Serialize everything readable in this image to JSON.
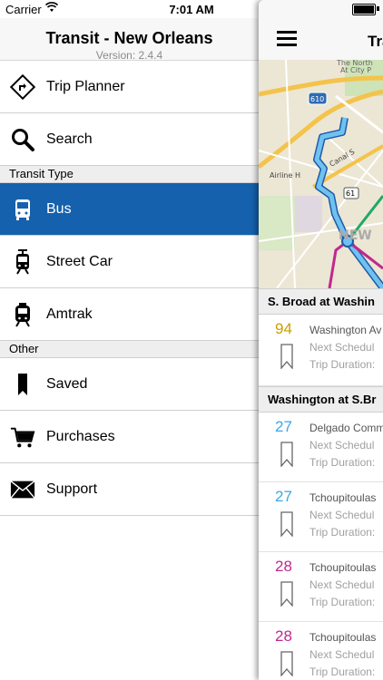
{
  "status": {
    "carrier": "Carrier",
    "time": "7:01 AM"
  },
  "menu": {
    "title": "Transit - New Orleans",
    "version": "Version: 2.4.4",
    "items_top": [
      {
        "label": "Trip Planner",
        "icon": "directions-sign-icon"
      },
      {
        "label": "Search",
        "icon": "search-icon"
      }
    ],
    "section_transit": "Transit Type",
    "items_transit": [
      {
        "label": "Bus",
        "icon": "bus-icon"
      },
      {
        "label": "Street Car",
        "icon": "streetcar-icon"
      },
      {
        "label": "Amtrak",
        "icon": "train-icon"
      }
    ],
    "section_other": "Other",
    "items_other": [
      {
        "label": "Saved",
        "icon": "bookmark-icon"
      },
      {
        "label": "Purchases",
        "icon": "cart-icon"
      },
      {
        "label": "Support",
        "icon": "envelope-icon"
      }
    ],
    "selected_color": "#1561ad"
  },
  "panel": {
    "nav_title": "Transi",
    "map": {
      "labels": [
        "The North",
        "At City P",
        "610",
        "Canal S",
        "Airline H",
        "61",
        "NEW"
      ]
    },
    "stop1": {
      "name": "S. Broad at Washin",
      "arrivals": [
        {
          "route": "94",
          "color": "#c9a000",
          "dest": "Washington Av",
          "next": "Next Schedul",
          "duration": "Trip Duration:"
        }
      ]
    },
    "stop2": {
      "name": "Washington at S.Br",
      "arrivals": [
        {
          "route": "27",
          "color": "#3da6e6",
          "dest": "Delgado Comm",
          "next": "Next Schedul",
          "duration": "Trip Duration:"
        },
        {
          "route": "27",
          "color": "#3da6e6",
          "dest": "Tchoupitoulas",
          "next": "Next Schedul",
          "duration": "Trip Duration:"
        },
        {
          "route": "28",
          "color": "#c0288e",
          "dest": "Tchoupitoulas",
          "next": "Next Schedul",
          "duration": "Trip Duration:"
        },
        {
          "route": "28",
          "color": "#c0288e",
          "dest": "Tchoupitoulas",
          "next": "Next Schedul",
          "duration": "Trip Duration:"
        }
      ]
    }
  }
}
